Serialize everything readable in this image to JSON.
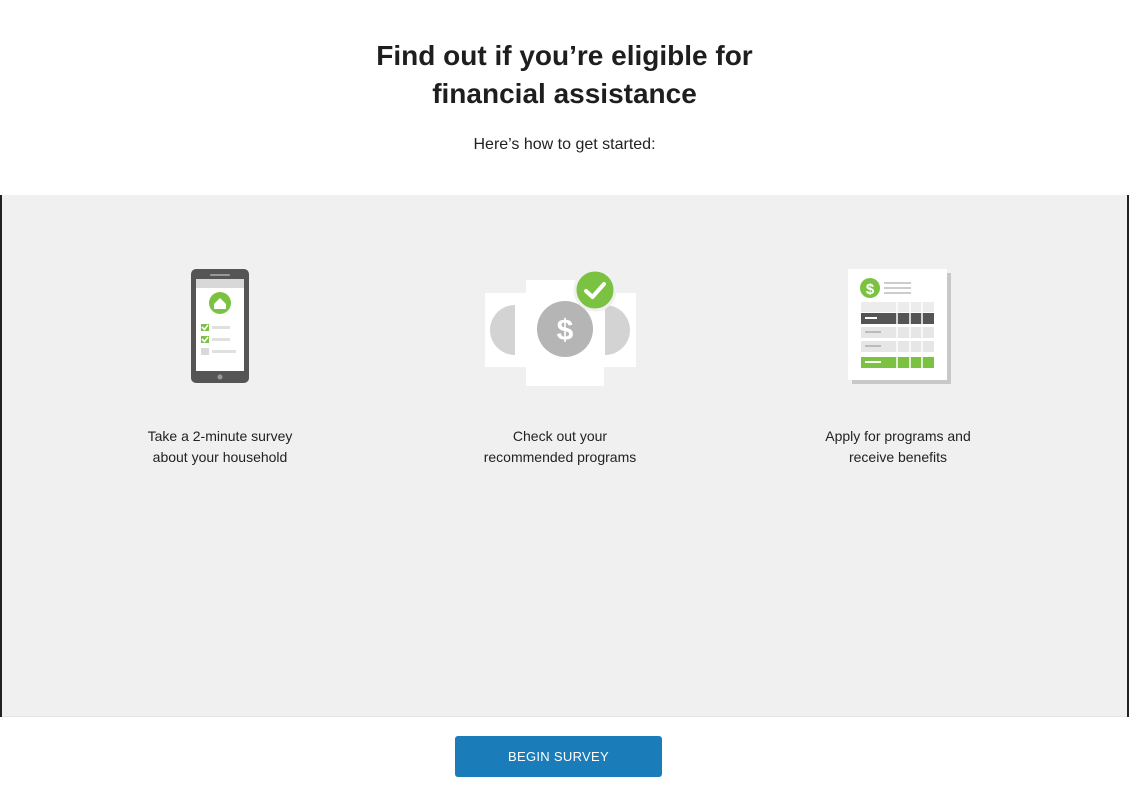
{
  "header": {
    "title_line1": "Find out if you’re eligible for",
    "title_line2": "financial assistance",
    "subtitle": "Here’s how to get started:"
  },
  "steps": [
    {
      "icon": "phone-survey-icon",
      "caption_line1": "Take a 2-minute survey",
      "caption_line2": "about your household"
    },
    {
      "icon": "programs-check-icon",
      "caption_line1": "Check out your",
      "caption_line2": "recommended programs"
    },
    {
      "icon": "application-form-icon",
      "caption_line1": "Apply for programs and",
      "caption_line2": "receive benefits"
    }
  ],
  "footer": {
    "begin_label": "BEGIN SURVEY"
  },
  "colors": {
    "accent_green": "#7cc242",
    "button_blue": "#1a7cb8",
    "panel_gray": "#f0f0f0"
  }
}
